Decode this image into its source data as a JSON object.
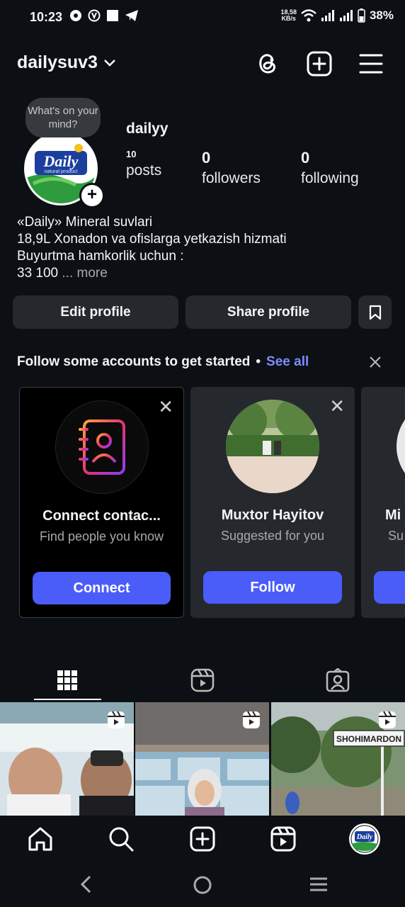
{
  "status_bar": {
    "time": "10:23",
    "net_speed_top": "18,58",
    "net_speed_bottom": "KB/s",
    "battery": "38%"
  },
  "header": {
    "username": "dailysuv3",
    "icons": [
      "threads-icon",
      "create-plus-icon",
      "menu-icon"
    ]
  },
  "profile": {
    "note_bubble": "What's on your mind?",
    "display_name": "dailyy",
    "posts_count": "10",
    "posts_label": "posts",
    "followers_count": "0",
    "followers_label": "followers",
    "following_count": "0",
    "following_label": "following",
    "bio_line1": "«Daily» Mineral suvlari",
    "bio_line2": "18,9L Xonadon va ofislarga yetkazish hizmati",
    "bio_line3": "Buyurtma hamkorlik uchun :",
    "bio_line4": "33 100",
    "bio_more": "... more",
    "logo_text": "Daily",
    "logo_subtext": "natural product"
  },
  "actions": {
    "edit_profile": "Edit profile",
    "share_profile": "Share profile"
  },
  "suggestions": {
    "heading": "Follow some accounts to get started",
    "see_all": "See all",
    "cards": [
      {
        "name": "Connect contac...",
        "subtitle": "Find people you know",
        "button": "Connect"
      },
      {
        "name": "Muxtor Hayitov",
        "subtitle": "Suggested for you",
        "button": "Follow"
      },
      {
        "name": "Mi",
        "subtitle": "Su",
        "button": ""
      }
    ]
  },
  "tabs": [
    "grid-icon",
    "reels-icon",
    "tagged-icon"
  ],
  "grid": {
    "thumb3_sign": "SHOHIMARDON"
  },
  "colors": {
    "background": "#0c1014",
    "button_bg": "#25292e",
    "accent_blue": "#4a5df9",
    "link_blue": "#7c8dff"
  }
}
